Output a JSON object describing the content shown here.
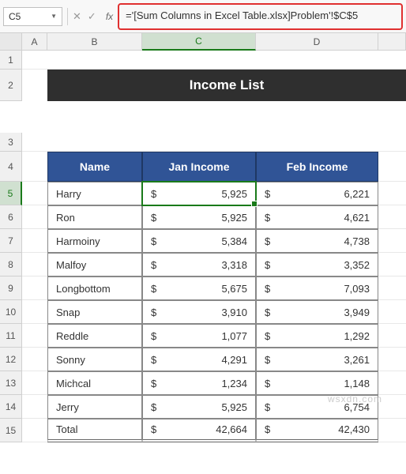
{
  "nameBox": {
    "value": "C5"
  },
  "formulaBar": {
    "value": "='[Sum Columns in Excel Table.xlsx]Problem'!$C$5"
  },
  "columns": [
    "A",
    "B",
    "C",
    "D"
  ],
  "title": "Income List",
  "headers": {
    "name": "Name",
    "jan": "Jan Income",
    "feb": "Feb Income"
  },
  "rows": [
    {
      "n": "5",
      "name": "Harry",
      "jan": "5,925",
      "feb": "6,221"
    },
    {
      "n": "6",
      "name": "Ron",
      "jan": "5,925",
      "feb": "4,621"
    },
    {
      "n": "7",
      "name": "Harmoiny",
      "jan": "5,384",
      "feb": "4,738"
    },
    {
      "n": "8",
      "name": "Malfoy",
      "jan": "3,318",
      "feb": "3,352"
    },
    {
      "n": "9",
      "name": "Longbottom",
      "jan": "5,675",
      "feb": "7,093"
    },
    {
      "n": "10",
      "name": "Snap",
      "jan": "3,910",
      "feb": "3,949"
    },
    {
      "n": "11",
      "name": "Reddle",
      "jan": "1,077",
      "feb": "1,292"
    },
    {
      "n": "12",
      "name": "Sonny",
      "jan": "4,291",
      "feb": "3,261"
    },
    {
      "n": "13",
      "name": "Michcal",
      "jan": "1,234",
      "feb": "1,148"
    },
    {
      "n": "14",
      "name": "Jerry",
      "jan": "5,925",
      "feb": "6,754"
    }
  ],
  "total": {
    "n": "15",
    "label": "Total",
    "jan": "42,664",
    "feb": "42,430"
  },
  "currency": "$",
  "watermark": "wsxdn.com",
  "earlyRows": [
    "1",
    "3"
  ],
  "headerRow": "4"
}
